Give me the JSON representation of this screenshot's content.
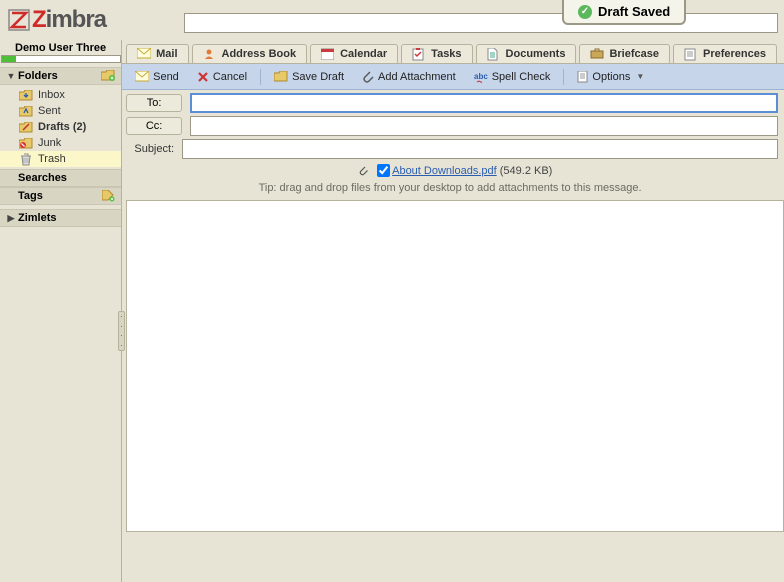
{
  "brand": "Zimbra",
  "user": {
    "name": "Demo User Three",
    "quota_pct": 12
  },
  "draft_badge": "Draft Saved",
  "sidebar": {
    "folders_label": "Folders",
    "searches_label": "Searches",
    "tags_label": "Tags",
    "zimlets_label": "Zimlets",
    "items": [
      {
        "label": "Inbox"
      },
      {
        "label": "Sent"
      },
      {
        "label": "Drafts (2)"
      },
      {
        "label": "Junk"
      },
      {
        "label": "Trash"
      }
    ]
  },
  "tabs": {
    "mail": "Mail",
    "address_book": "Address Book",
    "calendar": "Calendar",
    "tasks": "Tasks",
    "documents": "Documents",
    "briefcase": "Briefcase",
    "preferences": "Preferences"
  },
  "toolbar": {
    "send": "Send",
    "cancel": "Cancel",
    "save_draft": "Save Draft",
    "add_attachment": "Add Attachment",
    "spell_check": "Spell Check",
    "options": "Options"
  },
  "compose": {
    "to_label": "To:",
    "cc_label": "Cc:",
    "subject_label": "Subject:",
    "to_value": "",
    "cc_value": "",
    "subject_value": "",
    "attachment": {
      "name": "About Downloads.pdf",
      "size": "(549.2 KB)",
      "checked": true
    },
    "tip": "Tip: drag and drop files from your desktop to add attachments to this message."
  }
}
